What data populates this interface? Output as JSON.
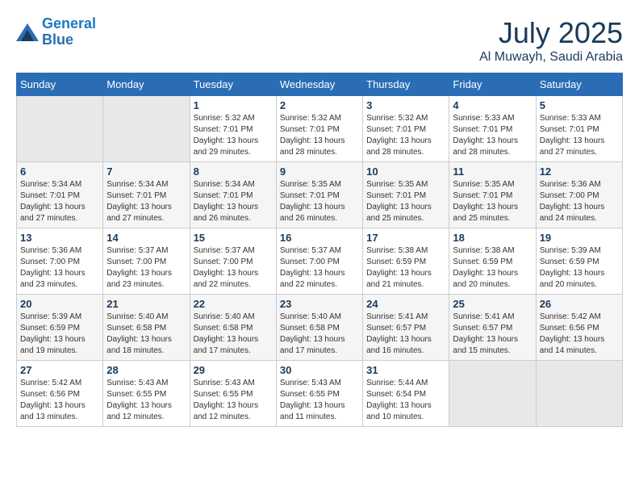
{
  "header": {
    "logo_line1": "General",
    "logo_line2": "Blue",
    "month": "July 2025",
    "location": "Al Muwayh, Saudi Arabia"
  },
  "weekdays": [
    "Sunday",
    "Monday",
    "Tuesday",
    "Wednesday",
    "Thursday",
    "Friday",
    "Saturday"
  ],
  "weeks": [
    [
      {
        "day": "",
        "info": ""
      },
      {
        "day": "",
        "info": ""
      },
      {
        "day": "1",
        "info": "Sunrise: 5:32 AM\nSunset: 7:01 PM\nDaylight: 13 hours and 29 minutes."
      },
      {
        "day": "2",
        "info": "Sunrise: 5:32 AM\nSunset: 7:01 PM\nDaylight: 13 hours and 28 minutes."
      },
      {
        "day": "3",
        "info": "Sunrise: 5:32 AM\nSunset: 7:01 PM\nDaylight: 13 hours and 28 minutes."
      },
      {
        "day": "4",
        "info": "Sunrise: 5:33 AM\nSunset: 7:01 PM\nDaylight: 13 hours and 28 minutes."
      },
      {
        "day": "5",
        "info": "Sunrise: 5:33 AM\nSunset: 7:01 PM\nDaylight: 13 hours and 27 minutes."
      }
    ],
    [
      {
        "day": "6",
        "info": "Sunrise: 5:34 AM\nSunset: 7:01 PM\nDaylight: 13 hours and 27 minutes."
      },
      {
        "day": "7",
        "info": "Sunrise: 5:34 AM\nSunset: 7:01 PM\nDaylight: 13 hours and 27 minutes."
      },
      {
        "day": "8",
        "info": "Sunrise: 5:34 AM\nSunset: 7:01 PM\nDaylight: 13 hours and 26 minutes."
      },
      {
        "day": "9",
        "info": "Sunrise: 5:35 AM\nSunset: 7:01 PM\nDaylight: 13 hours and 26 minutes."
      },
      {
        "day": "10",
        "info": "Sunrise: 5:35 AM\nSunset: 7:01 PM\nDaylight: 13 hours and 25 minutes."
      },
      {
        "day": "11",
        "info": "Sunrise: 5:35 AM\nSunset: 7:01 PM\nDaylight: 13 hours and 25 minutes."
      },
      {
        "day": "12",
        "info": "Sunrise: 5:36 AM\nSunset: 7:00 PM\nDaylight: 13 hours and 24 minutes."
      }
    ],
    [
      {
        "day": "13",
        "info": "Sunrise: 5:36 AM\nSunset: 7:00 PM\nDaylight: 13 hours and 23 minutes."
      },
      {
        "day": "14",
        "info": "Sunrise: 5:37 AM\nSunset: 7:00 PM\nDaylight: 13 hours and 23 minutes."
      },
      {
        "day": "15",
        "info": "Sunrise: 5:37 AM\nSunset: 7:00 PM\nDaylight: 13 hours and 22 minutes."
      },
      {
        "day": "16",
        "info": "Sunrise: 5:37 AM\nSunset: 7:00 PM\nDaylight: 13 hours and 22 minutes."
      },
      {
        "day": "17",
        "info": "Sunrise: 5:38 AM\nSunset: 6:59 PM\nDaylight: 13 hours and 21 minutes."
      },
      {
        "day": "18",
        "info": "Sunrise: 5:38 AM\nSunset: 6:59 PM\nDaylight: 13 hours and 20 minutes."
      },
      {
        "day": "19",
        "info": "Sunrise: 5:39 AM\nSunset: 6:59 PM\nDaylight: 13 hours and 20 minutes."
      }
    ],
    [
      {
        "day": "20",
        "info": "Sunrise: 5:39 AM\nSunset: 6:59 PM\nDaylight: 13 hours and 19 minutes."
      },
      {
        "day": "21",
        "info": "Sunrise: 5:40 AM\nSunset: 6:58 PM\nDaylight: 13 hours and 18 minutes."
      },
      {
        "day": "22",
        "info": "Sunrise: 5:40 AM\nSunset: 6:58 PM\nDaylight: 13 hours and 17 minutes."
      },
      {
        "day": "23",
        "info": "Sunrise: 5:40 AM\nSunset: 6:58 PM\nDaylight: 13 hours and 17 minutes."
      },
      {
        "day": "24",
        "info": "Sunrise: 5:41 AM\nSunset: 6:57 PM\nDaylight: 13 hours and 16 minutes."
      },
      {
        "day": "25",
        "info": "Sunrise: 5:41 AM\nSunset: 6:57 PM\nDaylight: 13 hours and 15 minutes."
      },
      {
        "day": "26",
        "info": "Sunrise: 5:42 AM\nSunset: 6:56 PM\nDaylight: 13 hours and 14 minutes."
      }
    ],
    [
      {
        "day": "27",
        "info": "Sunrise: 5:42 AM\nSunset: 6:56 PM\nDaylight: 13 hours and 13 minutes."
      },
      {
        "day": "28",
        "info": "Sunrise: 5:43 AM\nSunset: 6:55 PM\nDaylight: 13 hours and 12 minutes."
      },
      {
        "day": "29",
        "info": "Sunrise: 5:43 AM\nSunset: 6:55 PM\nDaylight: 13 hours and 12 minutes."
      },
      {
        "day": "30",
        "info": "Sunrise: 5:43 AM\nSunset: 6:55 PM\nDaylight: 13 hours and 11 minutes."
      },
      {
        "day": "31",
        "info": "Sunrise: 5:44 AM\nSunset: 6:54 PM\nDaylight: 13 hours and 10 minutes."
      },
      {
        "day": "",
        "info": ""
      },
      {
        "day": "",
        "info": ""
      }
    ]
  ]
}
